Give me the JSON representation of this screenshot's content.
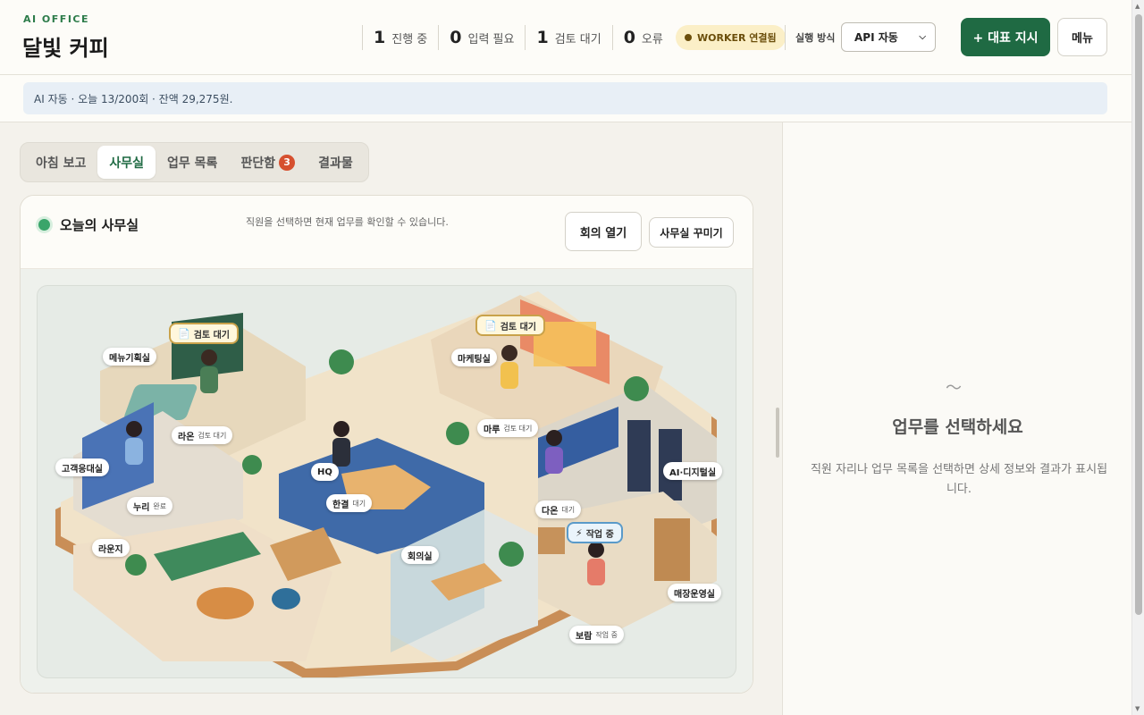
{
  "header": {
    "brand_sub": "AI OFFICE",
    "brand_title": "달빛 커피",
    "stats": [
      {
        "num": "1",
        "label": "진행 중"
      },
      {
        "num": "0",
        "label": "입력 필요"
      },
      {
        "num": "1",
        "label": "검토 대기"
      },
      {
        "num": "0",
        "label": "오류"
      }
    ],
    "worker_badge": "WORKER 연결됨",
    "mode_label": "실행 방식",
    "mode_value": "API 자동",
    "primary_button": "+ 대표 지시",
    "menu_button": "메뉴"
  },
  "infobar": {
    "text": "AI 자동 · 오늘 13/200회 · 잔액 29,275원."
  },
  "tabs": [
    {
      "label": "아침 보고",
      "active": false
    },
    {
      "label": "사무실",
      "active": true
    },
    {
      "label": "업무 목록",
      "active": false
    },
    {
      "label": "판단함",
      "active": false,
      "badge": "3"
    },
    {
      "label": "결과물",
      "active": false
    }
  ],
  "office": {
    "title": "오늘의 사무실",
    "hint": "직원을 선택하면 현재 업무를 확인할 수 있습니다.",
    "meeting_button": "회의 열기",
    "decorate_button": "사무실 꾸미기",
    "rooms": {
      "menu_lab": "메뉴기획실",
      "marketing": "마케팅실",
      "customer": "고객응대실",
      "hq": "HQ",
      "ai_digital": "AI·디지털실",
      "lounge": "라운지",
      "meeting_room": "회의실",
      "store_ops": "매장운영실"
    },
    "staff": {
      "raon": {
        "name": "라온",
        "status": "검토 대기"
      },
      "maru": {
        "name": "마루",
        "status": "검토 대기"
      },
      "nuri": {
        "name": "누리",
        "status": "완료"
      },
      "hangyeol": {
        "name": "한결",
        "status": "대기"
      },
      "daon": {
        "name": "다온",
        "status": "대기"
      },
      "boram": {
        "name": "보람",
        "status": "작업 중"
      }
    },
    "tags": {
      "review1": "검토 대기",
      "review2": "검토 대기",
      "working": "작업 중"
    }
  },
  "detail": {
    "icon": "pulse-icon",
    "empty_title": "업무를 선택하세요",
    "empty_desc": "직원 자리나 업무 목록을 선택하면 상세 정보와 결과가 표시됩니다."
  },
  "colors": {
    "accent": "#1f6a43",
    "badge": "#d6502f",
    "worker_bg": "#fbefc7"
  }
}
